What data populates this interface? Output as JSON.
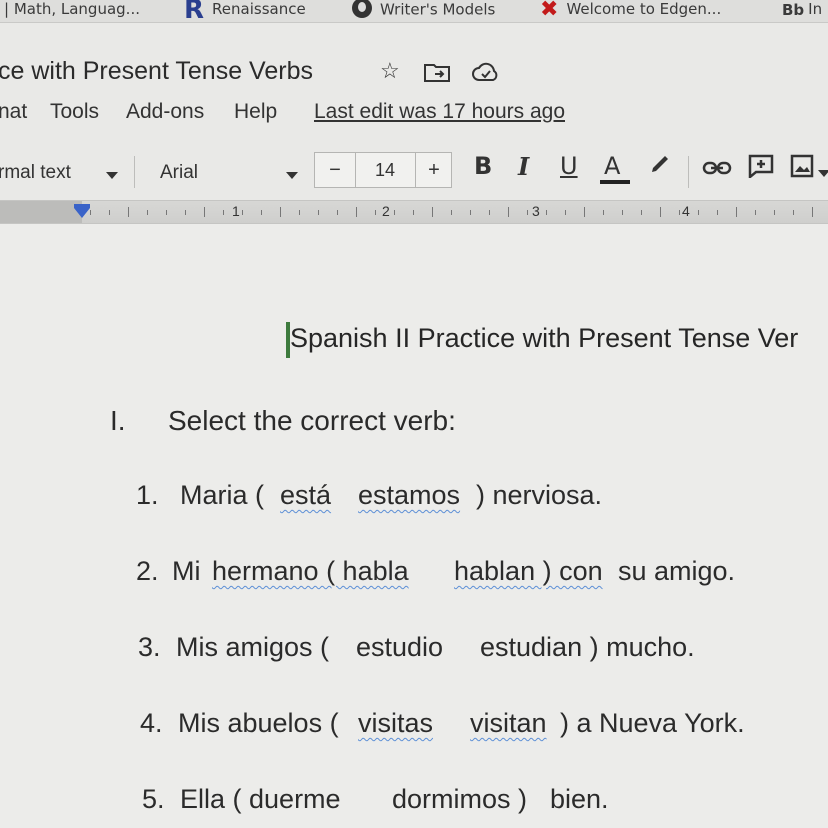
{
  "bookmarks": [
    {
      "label": "| Math, Languag...",
      "icon": ""
    },
    {
      "label": "Renaissance",
      "icon": "renaissance-r-icon"
    },
    {
      "label": "Writer's Models",
      "icon": "globe-icon"
    },
    {
      "label": "Welcome to Edgen...",
      "icon": "edgenuity-x-icon"
    },
    {
      "label": "In",
      "icon": "blackboard-icon",
      "icon_text": "Bb"
    }
  ],
  "doc": {
    "title": "ce with Present Tense Verbs",
    "last_edit": "Last edit was 17 hours ago"
  },
  "menu": [
    "nat",
    "Tools",
    "Add-ons",
    "Help"
  ],
  "toolbar": {
    "style": "rmal text",
    "font": "Arial",
    "font_size": "14",
    "minus": "−",
    "plus": "+",
    "bold": "B",
    "italic": "I",
    "underline": "U",
    "text_color": "A"
  },
  "ruler": {
    "numbers": [
      "1",
      "2",
      "3",
      "4"
    ]
  },
  "content": {
    "heading": "Spanish II Practice with Present Tense Ver",
    "section_num": "I.",
    "section_title": "Select the correct verb:",
    "items": [
      {
        "num": "1.",
        "parts": [
          "Maria (",
          "está",
          "estamos",
          ") nerviosa."
        ]
      },
      {
        "num": "2.",
        "parts": [
          "Mi",
          "hermano ( habla",
          "hablan ) con",
          "su amigo."
        ]
      },
      {
        "num": "3.",
        "parts": [
          "Mis amigos (",
          "estudio",
          "estudian ) mucho."
        ]
      },
      {
        "num": "4.",
        "parts": [
          "Mis abuelos (",
          "visitas",
          "visitan",
          ") a Nueva York."
        ]
      },
      {
        "num": "5.",
        "parts": [
          "Ella ( duerme",
          "dormimos )",
          "bien."
        ]
      }
    ]
  },
  "colors": {
    "accent_blue": "#3a63c8",
    "spell_underline": "#5c8fd6",
    "cursor": "#3d7a3d"
  }
}
